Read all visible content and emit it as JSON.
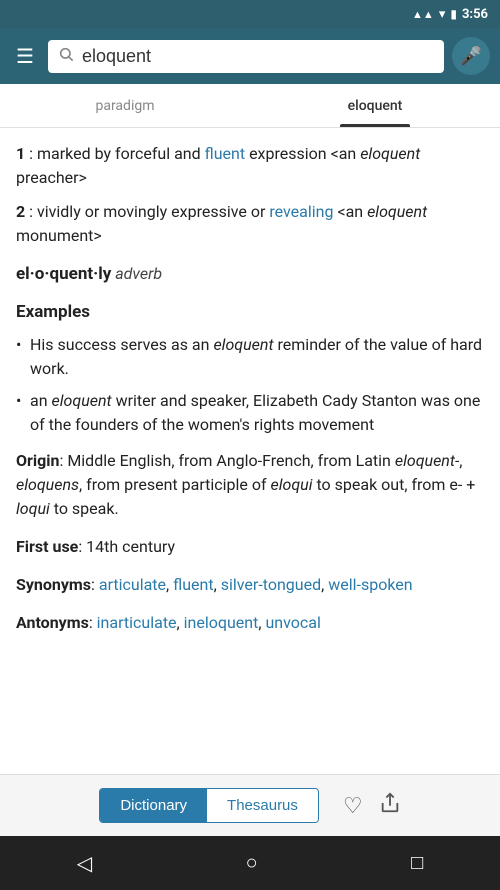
{
  "status": {
    "time": "3:56",
    "signal": "▲",
    "wifi": "▼",
    "battery": "🔋"
  },
  "search": {
    "query": "eloquent",
    "placeholder": "Search"
  },
  "tabs": [
    {
      "id": "paradigm",
      "label": "paradigm",
      "active": false
    },
    {
      "id": "eloquent",
      "label": "eloquent",
      "active": true
    }
  ],
  "content": {
    "definition1_num": "1",
    "definition1_colon": " :",
    "definition1_text_before_link": " marked by forceful and ",
    "definition1_link": "fluent",
    "definition1_text_after": " expression <an ",
    "definition1_italic": "eloquent",
    "definition1_end": " preacher>",
    "definition2_num": "2",
    "definition2_colon": " :",
    "definition2_text": " vividly or movingly expressive or ",
    "definition2_link": "revealing",
    "definition2_text2": " <an ",
    "definition2_italic": "eloquent",
    "definition2_end": " monument>",
    "word_form": "el·o·quent·ly",
    "word_pos": " adverb",
    "examples_title": "Examples",
    "examples": [
      "His success serves as an <i>eloquent</i> reminder of the value of hard work.",
      "an <i>eloquent</i> writer and speaker, Elizabeth Cady Stanton was one of the founders of the women's rights movement"
    ],
    "origin_label": "Origin",
    "origin_text": ": Middle English, from Anglo-French, from Latin ",
    "origin_italic1": "eloquent-",
    "origin_comma": ", ",
    "origin_italic2": "eloquens",
    "origin_text2": ", from present participle of ",
    "origin_italic3": "eloqui",
    "origin_text3": " to speak out, from ",
    "origin_text4": "e- + ",
    "origin_italic4": "loqui",
    "origin_text5": " to speak.",
    "first_use_label": "First use",
    "first_use_text": ": 14th century",
    "synonyms_label": "Synonyms",
    "synonyms_links": [
      "articulate",
      "fluent",
      "silver-tongued",
      "well-spoken"
    ],
    "antonyms_label": "Antonyms",
    "antonyms_links": [
      "inarticulate",
      "ineloquent",
      "unvocal"
    ]
  },
  "bottom": {
    "dict_label": "Dictionary",
    "thesaurus_label": "Thesaurus",
    "heart_icon": "♡",
    "share_icon": "⎙"
  },
  "nav": {
    "back_icon": "◁",
    "home_icon": "○",
    "square_icon": "□"
  }
}
